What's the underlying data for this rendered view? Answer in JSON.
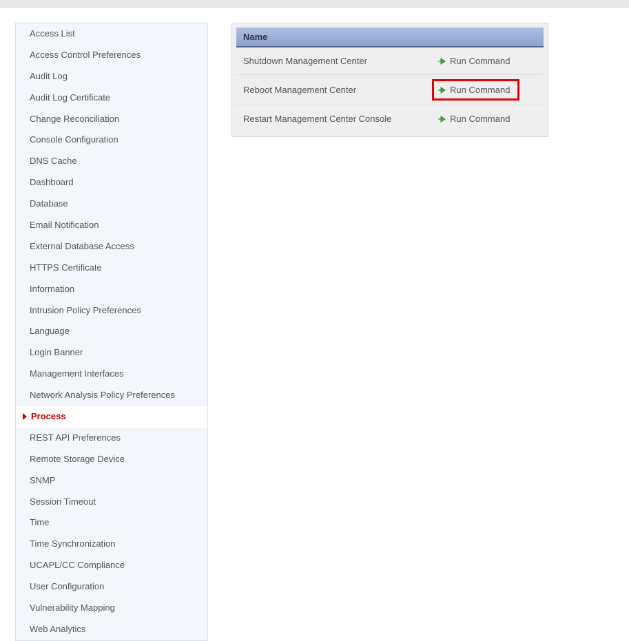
{
  "sidebar": {
    "items": [
      {
        "label": "Access List",
        "selected": false
      },
      {
        "label": "Access Control Preferences",
        "selected": false
      },
      {
        "label": "Audit Log",
        "selected": false
      },
      {
        "label": "Audit Log Certificate",
        "selected": false
      },
      {
        "label": "Change Reconciliation",
        "selected": false
      },
      {
        "label": "Console Configuration",
        "selected": false
      },
      {
        "label": "DNS Cache",
        "selected": false
      },
      {
        "label": "Dashboard",
        "selected": false
      },
      {
        "label": "Database",
        "selected": false
      },
      {
        "label": "Email Notification",
        "selected": false
      },
      {
        "label": "External Database Access",
        "selected": false
      },
      {
        "label": "HTTPS Certificate",
        "selected": false
      },
      {
        "label": "Information",
        "selected": false
      },
      {
        "label": "Intrusion Policy Preferences",
        "selected": false
      },
      {
        "label": "Language",
        "selected": false
      },
      {
        "label": "Login Banner",
        "selected": false
      },
      {
        "label": "Management Interfaces",
        "selected": false
      },
      {
        "label": "Network Analysis Policy Preferences",
        "selected": false
      },
      {
        "label": "Process",
        "selected": true
      },
      {
        "label": "REST API Preferences",
        "selected": false
      },
      {
        "label": "Remote Storage Device",
        "selected": false
      },
      {
        "label": "SNMP",
        "selected": false
      },
      {
        "label": "Session Timeout",
        "selected": false
      },
      {
        "label": "Time",
        "selected": false
      },
      {
        "label": "Time Synchronization",
        "selected": false
      },
      {
        "label": "UCAPL/CC Compliance",
        "selected": false
      },
      {
        "label": "User Configuration",
        "selected": false
      },
      {
        "label": "Vulnerability Mapping",
        "selected": false
      },
      {
        "label": "Web Analytics",
        "selected": false
      }
    ]
  },
  "table": {
    "header_name": "Name",
    "rows": [
      {
        "name": "Shutdown Management Center",
        "action": "Run Command",
        "highlight": false
      },
      {
        "name": "Reboot Management Center",
        "action": "Run Command",
        "highlight": true
      },
      {
        "name": "Restart Management Center Console",
        "action": "Run Command",
        "highlight": false
      }
    ]
  }
}
